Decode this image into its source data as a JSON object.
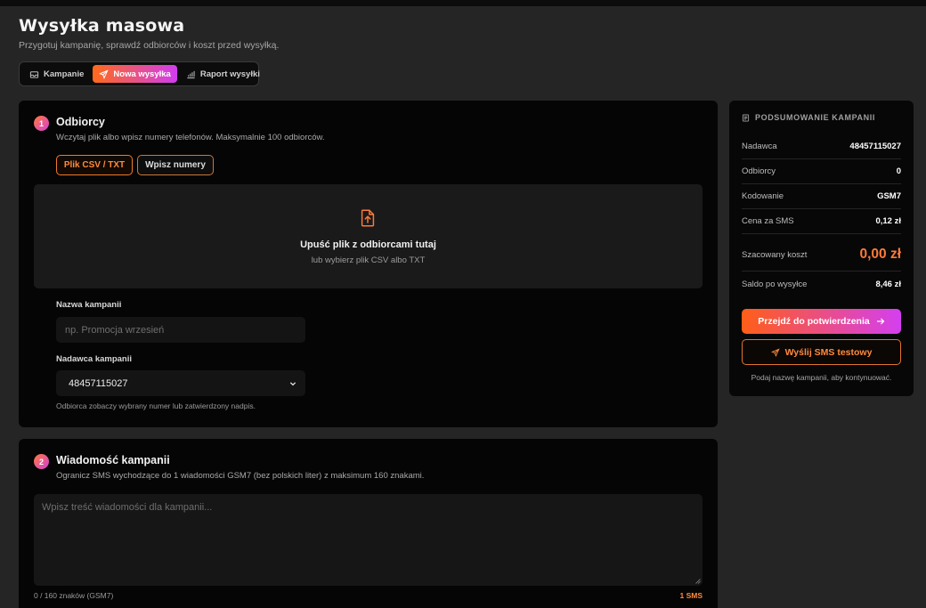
{
  "header": {
    "title": "Wysyłka masowa",
    "subtitle": "Przygotuj kampanię, sprawdź odbiorców i koszt przed wysyłką."
  },
  "tabs": [
    {
      "label": "Kampanie",
      "icon": "inbox-icon",
      "active": false
    },
    {
      "label": "Nowa wysyłka",
      "icon": "send-icon",
      "active": true
    },
    {
      "label": "Raport wysyłki",
      "icon": "bar-chart-icon",
      "active": false
    }
  ],
  "recipients": {
    "step": "1",
    "title": "Odbiorcy",
    "description": "Wczytaj plik albo wpisz numery telefonów. Maksymalnie 100 odbiorców.",
    "mode_csv": "Plik CSV / TXT",
    "mode_manual": "Wpisz numery",
    "dropzone_title": "Upuść plik z odbiorcami tutaj",
    "dropzone_sub": "lub wybierz plik CSV albo TXT",
    "campaign_name_label": "Nazwa kampanii",
    "campaign_name_placeholder": "np. Promocja wrzesień",
    "campaign_name_value": "",
    "sender_label": "Nadawca kampanii",
    "sender_value": "48457115027",
    "sender_hint": "Odbiorca zobaczy wybrany numer lub zatwierdzony nadpis."
  },
  "message": {
    "step": "2",
    "title": "Wiadomość kampanii",
    "description": "Ogranicz SMS wychodzące do 1 wiadomości GSM7 (bez polskich liter) z maksimum 160 znakami.",
    "placeholder": "Wpisz treść wiadomości dla kampanii...",
    "value": "",
    "counter": "0 / 160 znaków (GSM7)",
    "sms_count": "1 SMS"
  },
  "summary": {
    "title": "PODSUMOWANIE KAMPANII",
    "rows": [
      {
        "label": "Nadawca",
        "value": "48457115027"
      },
      {
        "label": "Odbiorcy",
        "value": "0"
      },
      {
        "label": "Kodowanie",
        "value": "GSM7"
      },
      {
        "label": "Cena za SMS",
        "value": "0,12 zł"
      }
    ],
    "cost_label": "Szacowany koszt",
    "cost_value": "0,00 zł",
    "balance_label": "Saldo po wysyłce",
    "balance_value": "8,46 zł",
    "confirm_button": "Przejdź do potwierdzenia",
    "test_button": "Wyślij SMS testowy",
    "note": "Podaj nazwę kampanii, aby kontynuować."
  },
  "colors": {
    "accent_orange": "#ff7a3a",
    "accent_magenta": "#d43ff0",
    "background": "#252525",
    "card": "#050505"
  }
}
